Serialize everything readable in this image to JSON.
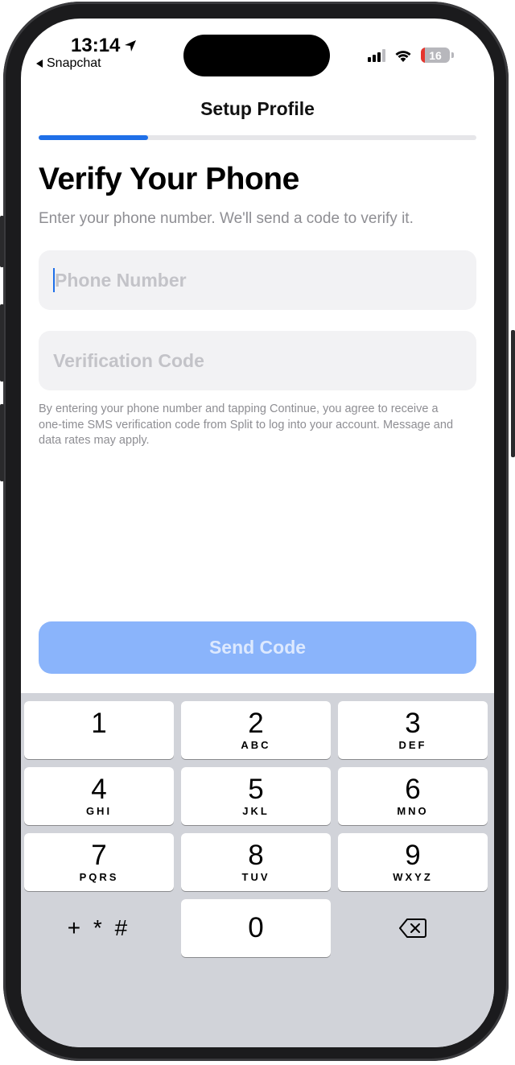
{
  "status_bar": {
    "time": "13:14",
    "back_app": "Snapchat",
    "battery": "16"
  },
  "nav": {
    "title": "Setup Profile"
  },
  "progress": {
    "fraction": 0.25,
    "accent": "#1f6fe8"
  },
  "page": {
    "heading": "Verify Your Phone",
    "subtext": "Enter your phone number. We'll send a code to verify it.",
    "phone_placeholder": "Phone Number",
    "code_placeholder": "Verification Code",
    "disclaimer": "By entering your phone number and tapping Continue, you agree to receive a one-time SMS verification code from Split to log into your account. Message and data rates may apply.",
    "send_button": "Send Code"
  },
  "keypad": {
    "keys": [
      {
        "num": "1",
        "letters": ""
      },
      {
        "num": "2",
        "letters": "ABC"
      },
      {
        "num": "3",
        "letters": "DEF"
      },
      {
        "num": "4",
        "letters": "GHI"
      },
      {
        "num": "5",
        "letters": "JKL"
      },
      {
        "num": "6",
        "letters": "MNO"
      },
      {
        "num": "7",
        "letters": "PQRS"
      },
      {
        "num": "8",
        "letters": "TUV"
      },
      {
        "num": "9",
        "letters": "WXYZ"
      },
      {
        "num": "0",
        "letters": ""
      }
    ],
    "symbols": "+ * #",
    "delete_icon": "backspace-icon"
  }
}
